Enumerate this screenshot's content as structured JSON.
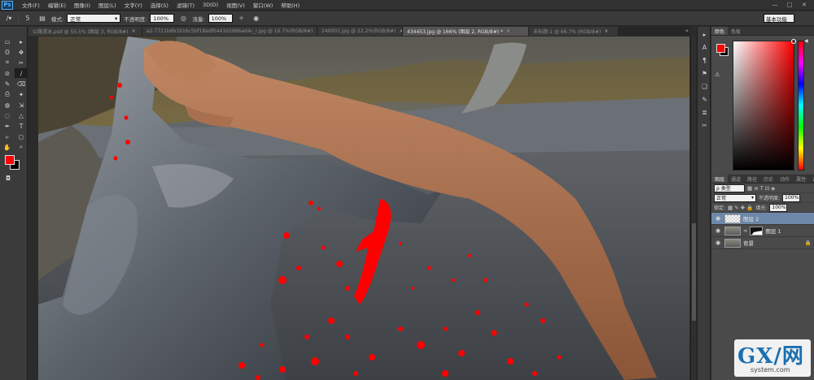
{
  "app": {
    "logo": "Ps"
  },
  "menu": [
    "文件(F)",
    "编辑(E)",
    "图像(I)",
    "图层(L)",
    "文字(Y)",
    "选择(S)",
    "滤镜(T)",
    "3D(D)",
    "视图(V)",
    "窗口(W)",
    "帮助(H)"
  ],
  "window_buttons": [
    "—",
    "□",
    "✕"
  ],
  "options": {
    "mode_label": "模式:",
    "mode_value": "正常",
    "opacity_label": "不透明度:",
    "opacity_value": "100%",
    "flow_label": "流量:",
    "flow_value": "100%",
    "brush_size": "5",
    "workspace": "基本功能"
  },
  "tabs": [
    {
      "label": "公路游泳.psd @ 55.5% (图层 3, RGB/8#)",
      "close": "×",
      "active": false
    },
    {
      "label": "a2-7721b6b1b16c5bf18adf6441b5986ad4c_r.jpg @ 16.7%(RGB/8#)",
      "close": "×",
      "active": false
    },
    {
      "label": "240001.jpg @ 22.2%(RGB/8#)",
      "close": "×",
      "active": false
    },
    {
      "label": "434453.jpg @ 166% (图层 2, RGB/8#) *",
      "close": "×",
      "active": true
    },
    {
      "label": "未标题-1 @ 66.7% (RGB/8#)",
      "close": "×",
      "active": false
    }
  ],
  "tab_more": "»",
  "tools": [
    "▭",
    "▸",
    "ʘ",
    "✥",
    "⌗",
    "✂",
    "⊘",
    "∕",
    "✎",
    "⌫",
    "⎙",
    "✦",
    "◍",
    "⇲",
    "◌",
    "△",
    "✒",
    "T",
    "▹",
    "◻",
    "✋",
    "⌕"
  ],
  "ministrip": [
    "▸",
    "A",
    "¶",
    "⚑",
    "❏",
    "✎",
    "≣",
    "✂"
  ],
  "color_panel": {
    "tabs": [
      "颜色",
      "色板"
    ],
    "warn": "⚠"
  },
  "layers_panel": {
    "tabs": [
      "图层",
      "通道",
      "路径",
      "历史",
      "动作",
      "属性",
      "调整"
    ],
    "filter_label": "ρ 类型",
    "filter_icons": "▦ ⊘ T ⊡ ◈",
    "blend": "正常",
    "opacity_label": "不透明度:",
    "opacity_value": "100%",
    "lock_label": "锁定:",
    "lock_icons": "▦ ✎ ✥ 🔒",
    "fill_label": "填充:",
    "fill_value": "100%",
    "layers": [
      {
        "name": "图层 2",
        "active": true
      },
      {
        "name": "图层 1",
        "active": false
      },
      {
        "name": "背景",
        "active": false
      }
    ],
    "lock_glyph": "🔒"
  },
  "watermark": {
    "text": "GX/网",
    "sub": "system.com"
  },
  "colors": {
    "accent": "#ff0000",
    "panel": "#454545",
    "active_layer": "#6d88a8"
  }
}
